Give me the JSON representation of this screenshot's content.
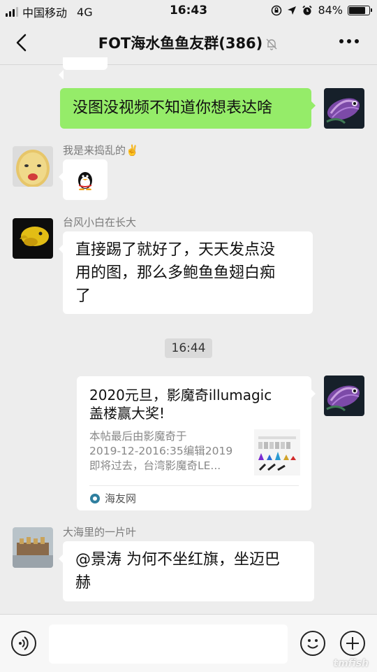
{
  "status_bar": {
    "carrier": "中国移动",
    "network": "4G",
    "time": "16:43",
    "battery": "84%",
    "battery_level": 0.84
  },
  "header": {
    "title": "FOT海水鱼鱼友群(386)",
    "muted_icon": "bell-off-icon",
    "back_icon": "chevron-left-icon",
    "more_icon": "more-dots-icon"
  },
  "messages": {
    "m1_text": "没图没视频不知道你想表达啥",
    "m2_sender": "我是来捣乱的✌️",
    "m2_content_icon": "penguin-emoji",
    "m3_sender": "台风小白在长大",
    "m3_line1": "直接踢了就好了，天天发点没",
    "m3_line2": "用的图，那么多鲍鱼鱼翅白痴",
    "m3_line3": "了",
    "timestamp": "16:44",
    "card_title_line1": "2020元旦，影魔奇illumagic",
    "card_title_line2": "盖楼赢大奖!",
    "card_desc_line1": "本帖最后由影魔奇于",
    "card_desc_line2": "2019-12-2016:35编辑2019",
    "card_desc_line3": "即将过去，台湾影魔奇LE...",
    "card_source": "海友网",
    "m5_sender": "大海里的一片叶",
    "m5_line1": "@景涛 为何不坐红旗，坐迈巴",
    "m5_line2": "赫"
  },
  "input_bar": {
    "voice_icon": "voice-icon",
    "emoji_icon": "emoji-icon",
    "plus_icon": "plus-icon"
  },
  "watermark": "tmfish",
  "colors": {
    "background": "#ededed",
    "my_bubble": "#95ec69",
    "their_bubble": "#ffffff"
  }
}
